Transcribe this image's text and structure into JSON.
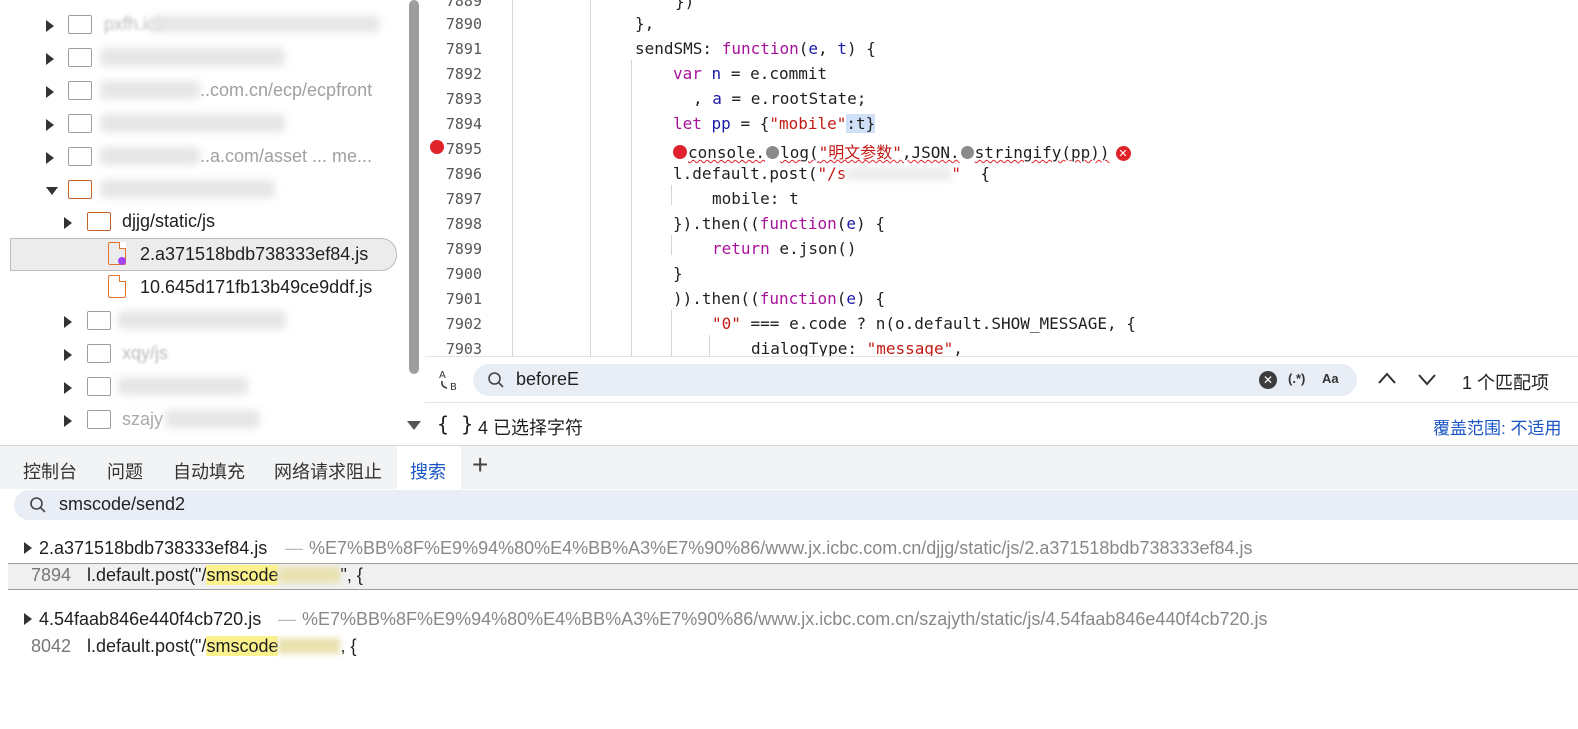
{
  "tree": {
    "items": [
      {
        "label": "pxfh.icb"
      },
      {
        "label": "..."
      },
      {
        "label": "..com.cn/ecp/ecpfront"
      },
      {
        "label": "..."
      },
      {
        "label": "..a.com/asset ... me..."
      },
      {
        "label": "..."
      },
      {
        "label": "djjg/static/js"
      },
      {
        "label": "2.a371518bdb738333ef84.js"
      },
      {
        "label": "10.645d171fb13b49ce9ddf.js"
      },
      {
        "label": "..."
      },
      {
        "label": "xqy/js"
      },
      {
        "label": "..."
      },
      {
        "label": "szajy"
      }
    ]
  },
  "editor": {
    "lines": [
      {
        "num": "7889",
        "text": "})"
      },
      {
        "num": "7890",
        "text": "},"
      },
      {
        "num": "7891",
        "text": "sendSMS: function(e, t) {"
      },
      {
        "num": "7892",
        "text": "var n = e.commit"
      },
      {
        "num": "7893",
        "text": ", a = e.rootState;"
      },
      {
        "num": "7894",
        "text": "let pp = {\"mobile\":t}"
      },
      {
        "num": "7895",
        "text": "console.log(\"明文参数\",JSON.stringify(pp))"
      },
      {
        "num": "7896",
        "text": "l.default.post(\"/s...\", {"
      },
      {
        "num": "7897",
        "text": "mobile: t"
      },
      {
        "num": "7898",
        "text": "}).then((function(e) {"
      },
      {
        "num": "7899",
        "text": "return e.json()"
      },
      {
        "num": "7900",
        "text": "}"
      },
      {
        "num": "7901",
        "text": ")).then((function(e) {"
      },
      {
        "num": "7902",
        "text": "\"0\" === e.code ? n(o.default.SHOW_MESSAGE, {"
      },
      {
        "num": "7903",
        "text": "dialogType: \"message\","
      }
    ]
  },
  "find": {
    "query": "beforeE",
    "regex_label": "(.*)",
    "case_label": "Aa",
    "match_count": "1 个匹配项"
  },
  "status": {
    "braces": "{ }",
    "selected": "4 已选择字符",
    "coverage": "覆盖范围: 不适用"
  },
  "drawer": {
    "tabs": [
      "控制台",
      "问题",
      "自动填充",
      "网络请求阻止",
      "搜索"
    ],
    "active_tab": "搜索",
    "add_label": "+"
  },
  "search": {
    "query": "smscode/send2",
    "results": [
      {
        "file": "2.a371518bdb738333ef84.js",
        "sep": "—",
        "path": "%E7%BB%8F%E9%94%80%E4%BB%A3%E7%90%86/www.jx.icbc.com.cn/djjg/static/js/2.a371518bdb738333ef84.js",
        "line_num": "7894",
        "prefix": "l.default.post(\"/",
        "match": "smscode",
        "suffix": "\", {"
      },
      {
        "file": "4.54faab846e440f4cb720.js",
        "sep": "—",
        "path": "%E7%BB%8F%E9%94%80%E4%BB%A3%E7%90%86/www.jx.icbc.com.cn/szajyth/static/js/4.54faab846e440f4cb720.js",
        "line_num": "8042",
        "prefix": "l.default.post(\"/",
        "match": "smscode",
        "suffix": ", {"
      }
    ]
  }
}
